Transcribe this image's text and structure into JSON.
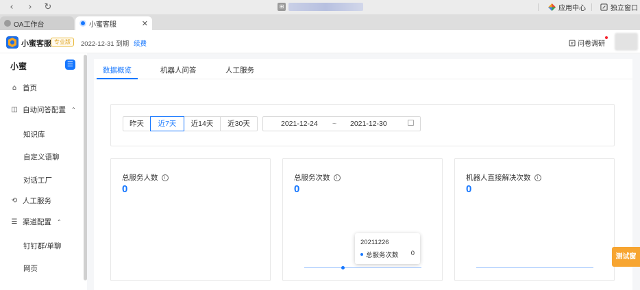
{
  "browser": {
    "back": "‹",
    "forward": "›",
    "reload": "↻",
    "app_center": "应用中心",
    "standalone_window": "独立窗口"
  },
  "tabs": [
    {
      "label": "OA工作台",
      "active": false
    },
    {
      "label": "小蜜客服",
      "active": true,
      "close": "✕"
    }
  ],
  "header": {
    "app_name": "小蜜客服",
    "edition_badge": "专业版",
    "expire_text": "2022-12-31 到期",
    "renew_link": "续费",
    "survey": "问卷调研"
  },
  "sidebar": {
    "title": "小蜜",
    "items": [
      {
        "label": "首页",
        "icon": "home-icon",
        "glyph": "⌂"
      },
      {
        "label": "自动问答配置",
        "icon": "qa-config-icon",
        "glyph": "◫",
        "caret": "⌃"
      },
      {
        "label": "知识库"
      },
      {
        "label": "自定义语聊"
      },
      {
        "label": "对话工厂"
      },
      {
        "label": "人工服务",
        "icon": "agent-icon",
        "glyph": "⟲"
      },
      {
        "label": "渠道配置",
        "icon": "channel-icon",
        "glyph": "☰",
        "caret": "⌃"
      },
      {
        "label": "钉钉群/单聊"
      },
      {
        "label": "网页"
      }
    ]
  },
  "main": {
    "tabs": [
      "数据概览",
      "机器人问答",
      "人工服务"
    ],
    "active_tab": 0,
    "ranges": [
      "昨天",
      "近7天",
      "近14天",
      "近30天"
    ],
    "active_range": 1,
    "date_start": "2021-12-24",
    "date_sep": "~",
    "date_end": "2021-12-30",
    "cards": [
      {
        "title": "总服务人数",
        "value": "0"
      },
      {
        "title": "总服务次数",
        "value": "0"
      },
      {
        "title": "机器人直接解决次数",
        "value": "0"
      }
    ],
    "tooltip": {
      "date": "20211226",
      "series": "总服务次数",
      "value": "0"
    }
  },
  "test_button": "测试窗",
  "colors": {
    "primary": "#1677ff",
    "badge": "#e0a520",
    "test_button": "#f7a531"
  }
}
